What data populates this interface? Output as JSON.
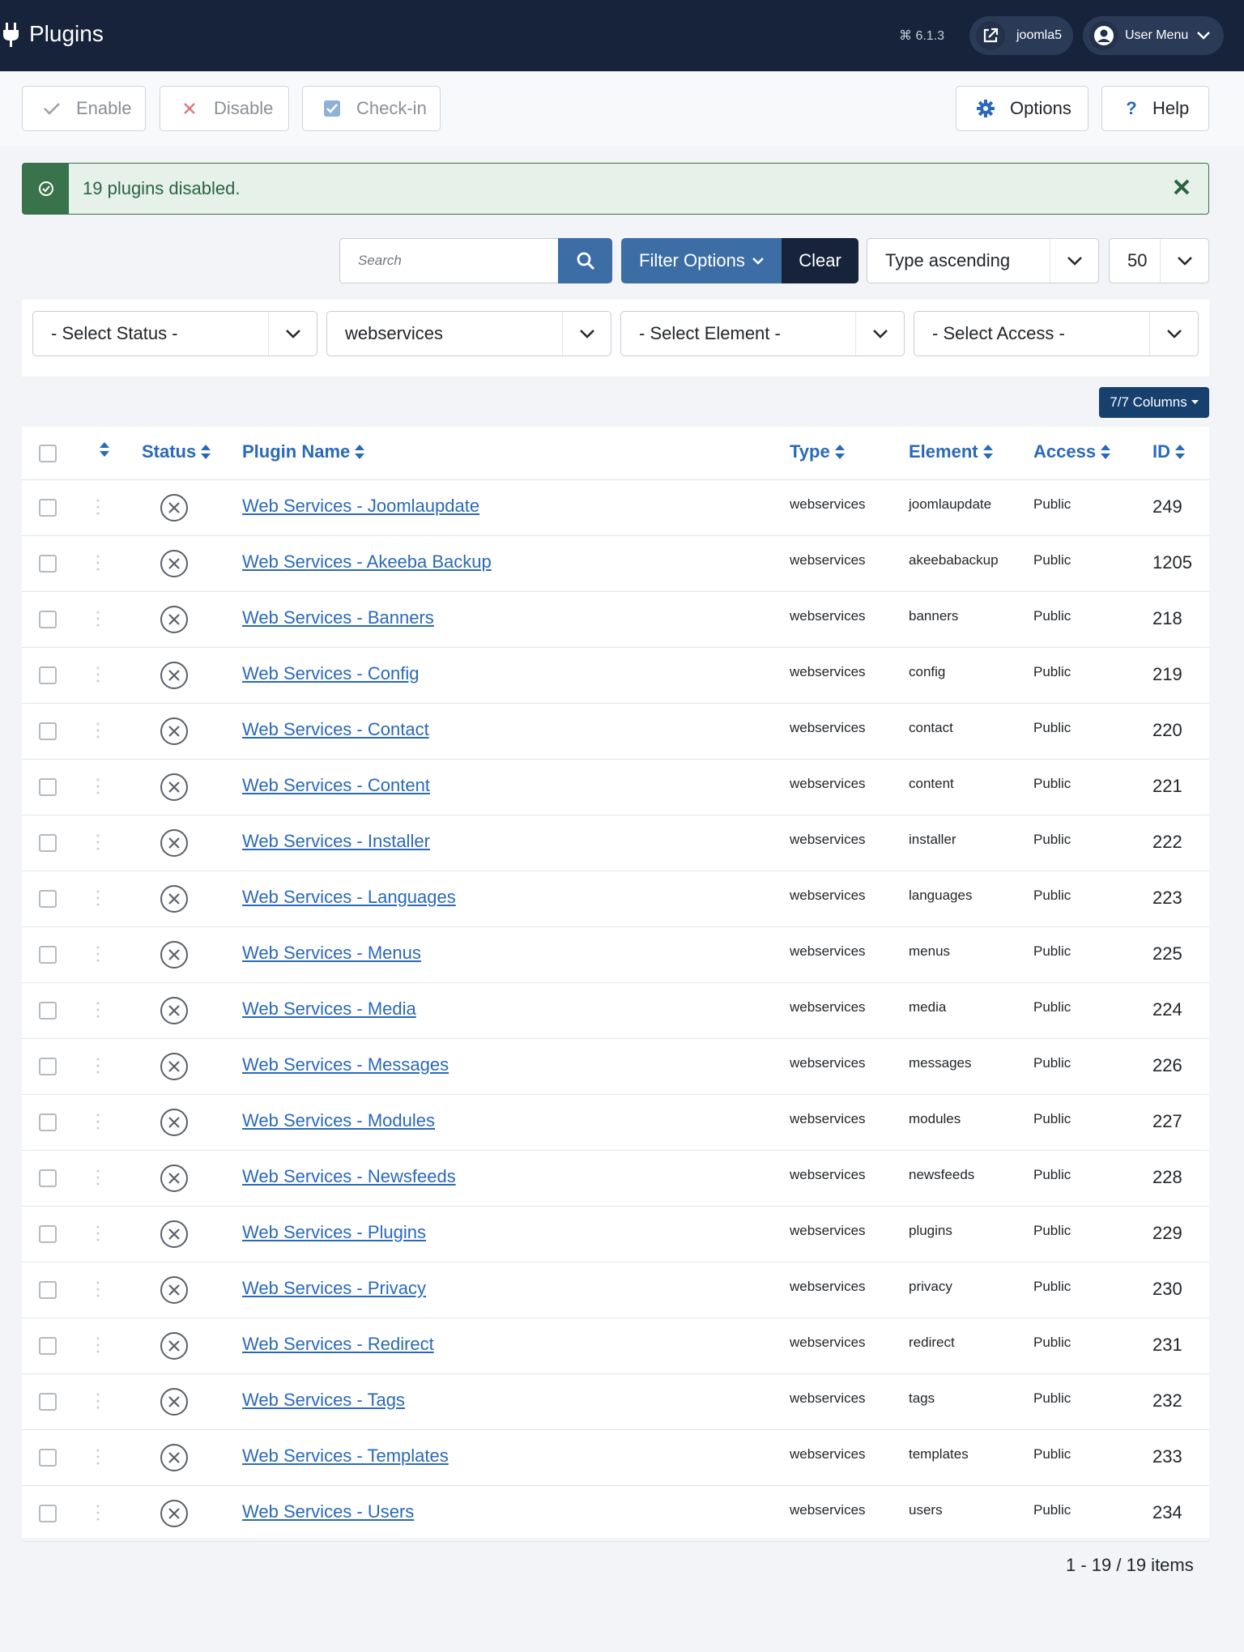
{
  "header": {
    "title": "Plugins",
    "version": "⌘ 6.1.3",
    "site_label": "joomla5",
    "user_label": "User Menu",
    "icons": [
      "plug-icon",
      "external-link-icon",
      "user-icon",
      "chevron-down-icon"
    ]
  },
  "toolbar": {
    "enable": "Enable",
    "disable": "Disable",
    "checkin": "Check-in",
    "options": "Options",
    "help": "Help"
  },
  "alert": {
    "message": "19 plugins disabled."
  },
  "search": {
    "placeholder": "Search",
    "filter_options": "Filter Options",
    "clear": "Clear",
    "ordering": "Type ascending",
    "limit": "50"
  },
  "filters": {
    "status": "- Select Status -",
    "folder": "webservices",
    "element": "- Select Element -",
    "access": "- Select Access -"
  },
  "columns_button": "7/7 Columns",
  "table": {
    "headers": {
      "status": "Status",
      "name": "Plugin Name",
      "type": "Type",
      "element": "Element",
      "access": "Access",
      "id": "ID"
    },
    "rows": [
      {
        "name": "Web Services - Joomlaupdate",
        "type": "webservices",
        "element": "joomlaupdate",
        "access": "Public",
        "id": "249"
      },
      {
        "name": "Web Services - Akeeba Backup",
        "type": "webservices",
        "element": "akeebabackup",
        "access": "Public",
        "id": "1205"
      },
      {
        "name": "Web Services - Banners",
        "type": "webservices",
        "element": "banners",
        "access": "Public",
        "id": "218"
      },
      {
        "name": "Web Services - Config",
        "type": "webservices",
        "element": "config",
        "access": "Public",
        "id": "219"
      },
      {
        "name": "Web Services - Contact",
        "type": "webservices",
        "element": "contact",
        "access": "Public",
        "id": "220"
      },
      {
        "name": "Web Services - Content",
        "type": "webservices",
        "element": "content",
        "access": "Public",
        "id": "221"
      },
      {
        "name": "Web Services - Installer",
        "type": "webservices",
        "element": "installer",
        "access": "Public",
        "id": "222"
      },
      {
        "name": "Web Services - Languages",
        "type": "webservices",
        "element": "languages",
        "access": "Public",
        "id": "223"
      },
      {
        "name": "Web Services - Menus",
        "type": "webservices",
        "element": "menus",
        "access": "Public",
        "id": "225"
      },
      {
        "name": "Web Services - Media",
        "type": "webservices",
        "element": "media",
        "access": "Public",
        "id": "224"
      },
      {
        "name": "Web Services - Messages",
        "type": "webservices",
        "element": "messages",
        "access": "Public",
        "id": "226"
      },
      {
        "name": "Web Services - Modules",
        "type": "webservices",
        "element": "modules",
        "access": "Public",
        "id": "227"
      },
      {
        "name": "Web Services - Newsfeeds",
        "type": "webservices",
        "element": "newsfeeds",
        "access": "Public",
        "id": "228"
      },
      {
        "name": "Web Services - Plugins",
        "type": "webservices",
        "element": "plugins",
        "access": "Public",
        "id": "229"
      },
      {
        "name": "Web Services - Privacy",
        "type": "webservices",
        "element": "privacy",
        "access": "Public",
        "id": "230"
      },
      {
        "name": "Web Services - Redirect",
        "type": "webservices",
        "element": "redirect",
        "access": "Public",
        "id": "231"
      },
      {
        "name": "Web Services - Tags",
        "type": "webservices",
        "element": "tags",
        "access": "Public",
        "id": "232"
      },
      {
        "name": "Web Services - Templates",
        "type": "webservices",
        "element": "templates",
        "access": "Public",
        "id": "233"
      },
      {
        "name": "Web Services - Users",
        "type": "webservices",
        "element": "users",
        "access": "Public",
        "id": "234"
      }
    ]
  },
  "pagination": "1 - 19 / 19 items",
  "colors": {
    "header_bg": "#17233a",
    "primary": "#3c6ea5",
    "link": "#2a69b8",
    "success": "#39734b"
  }
}
